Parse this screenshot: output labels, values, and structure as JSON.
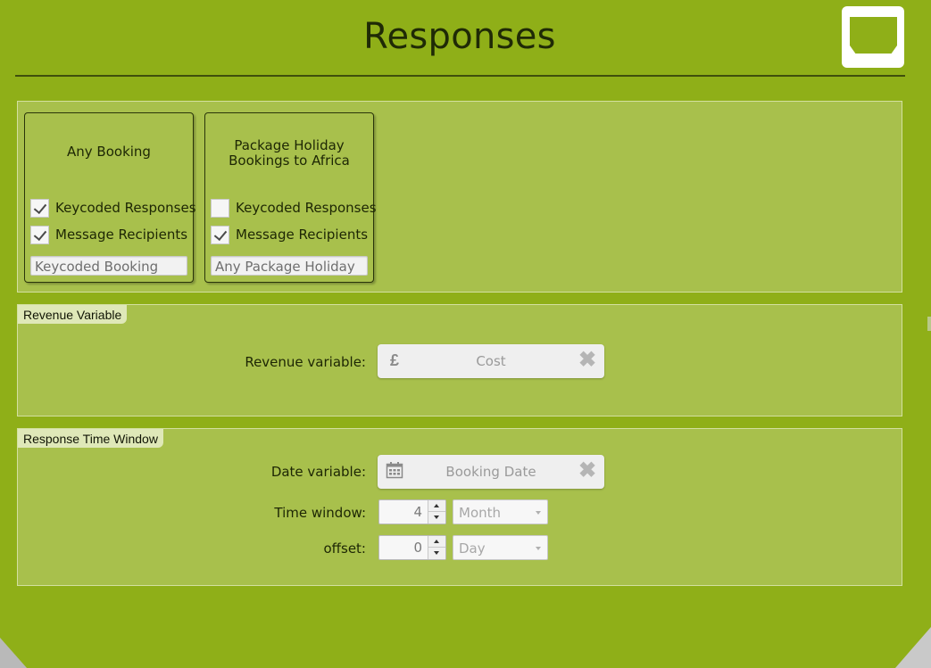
{
  "header": {
    "title": "Responses"
  },
  "corner_button": {
    "icon": "window-icon"
  },
  "cards": [
    {
      "title": "Any Booking",
      "checkboxes": [
        {
          "label": "Keycoded Responses",
          "checked": true
        },
        {
          "label": "Message Recipients",
          "checked": true
        }
      ],
      "input_value": "Keycoded Booking"
    },
    {
      "title": "Package Holiday Bookings to Africa",
      "checkboxes": [
        {
          "label": "Keycoded Responses",
          "checked": false
        },
        {
          "label": "Message Recipients",
          "checked": true
        }
      ],
      "input_value": "Any Package Holiday"
    }
  ],
  "revenue": {
    "section_label": "Revenue Variable",
    "field_label": "Revenue variable:",
    "icon": "pound-icon",
    "icon_glyph": "£",
    "value": "Cost",
    "clear_glyph": "✖"
  },
  "time_window": {
    "section_label": "Response Time Window",
    "date_label": "Date variable:",
    "date_icon": "calendar-icon",
    "date_value": "Booking Date",
    "window_label": "Time window:",
    "window_value": "4",
    "window_unit": "Month",
    "offset_label": "offset:",
    "offset_value": "0",
    "offset_unit": "Day",
    "clear_glyph": "✖"
  },
  "colors": {
    "panel": "#8faf18",
    "section": "#a8c04c",
    "text": "#1d2604"
  }
}
